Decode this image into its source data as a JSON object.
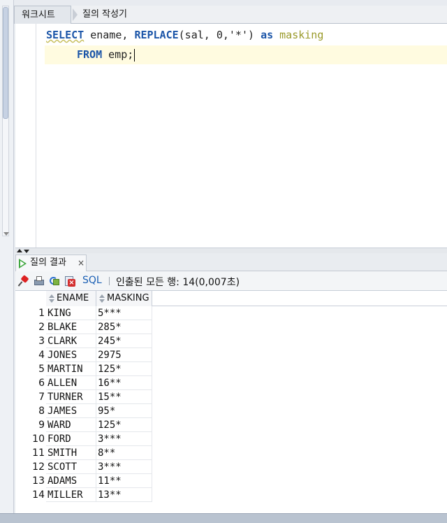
{
  "editor_tabs": [
    {
      "label": "워크시트"
    },
    {
      "label": "질의 작성기"
    }
  ],
  "sql": {
    "line1": {
      "kw_select": "SELECT",
      "col": " ename, ",
      "fn_replace": "REPLACE",
      "args": "(sal, 0,'*') ",
      "kw_as": "as",
      "alias": " masking"
    },
    "line2": {
      "kw_from": "FROM",
      "table": " emp;"
    }
  },
  "results_tab": {
    "label": "질의 결과",
    "close": "×"
  },
  "toolbar": {
    "sql_label": "SQL",
    "fetch_status": "인출된 모든 행: 14(0,007초)"
  },
  "grid": {
    "columns": [
      "ENAME",
      "MASKING"
    ],
    "rows": [
      {
        "n": "1",
        "ename": "KING",
        "masking": "5***"
      },
      {
        "n": "2",
        "ename": "BLAKE",
        "masking": "285*"
      },
      {
        "n": "3",
        "ename": "CLARK",
        "masking": "245*"
      },
      {
        "n": "4",
        "ename": "JONES",
        "masking": "2975"
      },
      {
        "n": "5",
        "ename": "MARTIN",
        "masking": "125*"
      },
      {
        "n": "6",
        "ename": "ALLEN",
        "masking": "16**"
      },
      {
        "n": "7",
        "ename": "TURNER",
        "masking": "15**"
      },
      {
        "n": "8",
        "ename": "JAMES",
        "masking": "95*"
      },
      {
        "n": "9",
        "ename": "WARD",
        "masking": "125*"
      },
      {
        "n": "10",
        "ename": "FORD",
        "masking": "3***"
      },
      {
        "n": "11",
        "ename": "SMITH",
        "masking": "8**"
      },
      {
        "n": "12",
        "ename": "SCOTT",
        "masking": "3***"
      },
      {
        "n": "13",
        "ename": "ADAMS",
        "masking": "11**"
      },
      {
        "n": "14",
        "ename": "MILLER",
        "masking": "13**"
      }
    ]
  },
  "icons": {
    "pin": "pin-icon",
    "print": "print-icon",
    "refresh": "refresh-icon",
    "cancel": "cancel-icon",
    "run": "play-icon"
  }
}
